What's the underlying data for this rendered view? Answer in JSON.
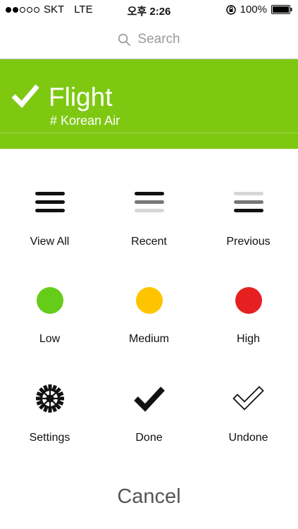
{
  "status_bar": {
    "carrier": "SKT",
    "network": "LTE",
    "time": "오후 2:26",
    "battery": "100%"
  },
  "search": {
    "placeholder": "Search"
  },
  "header": {
    "title": "Flight",
    "subtitle": "# Korean Air",
    "color": "#7ec812"
  },
  "actions": [
    {
      "label": "View All",
      "icon": "hamburger-icon"
    },
    {
      "label": "Recent",
      "icon": "recent-lines-icon"
    },
    {
      "label": "Previous",
      "icon": "previous-lines-icon"
    },
    {
      "label": "Low",
      "icon": "green-circle-icon",
      "color": "#66cc1a"
    },
    {
      "label": "Medium",
      "icon": "yellow-circle-icon",
      "color": "#ffc400"
    },
    {
      "label": "High",
      "icon": "red-circle-icon",
      "color": "#e62020"
    },
    {
      "label": "Settings",
      "icon": "gear-icon"
    },
    {
      "label": "Done",
      "icon": "checkmark-icon"
    },
    {
      "label": "Undone",
      "icon": "outline-check-icon"
    }
  ],
  "cancel_label": "Cancel"
}
